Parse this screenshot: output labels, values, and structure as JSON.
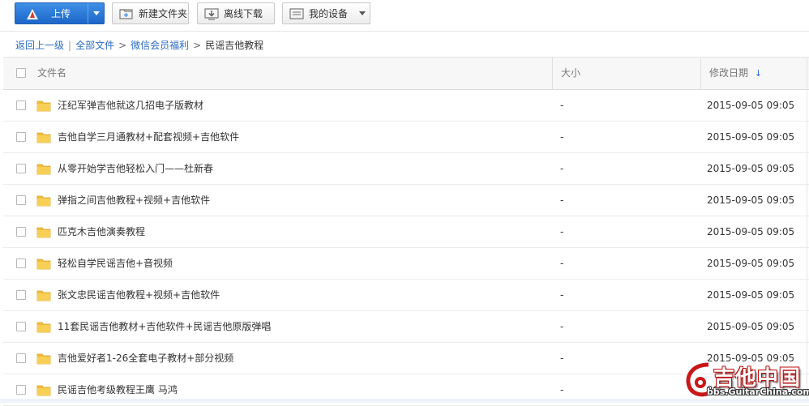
{
  "toolbar": {
    "upload_label": "上传",
    "new_folder_label": "新建文件夹",
    "offline_download_label": "离线下载",
    "my_devices_label": "我的设备"
  },
  "breadcrumb": {
    "back": "返回上一级",
    "all_files": "全部文件",
    "parent": "微信会员福利",
    "current": "民谣吉他教程",
    "separator": "|",
    "arrow": ">"
  },
  "table": {
    "columns": {
      "name": "文件名",
      "size": "大小",
      "modified": "修改日期"
    },
    "sort_indicator": "↓",
    "rows": [
      {
        "name": "汪纪军弹吉他就这几招电子版教材",
        "size": "-",
        "modified": "2015-09-05 09:05"
      },
      {
        "name": "吉他自学三月通教材+配套视频+吉他软件",
        "size": "-",
        "modified": "2015-09-05 09:05"
      },
      {
        "name": "从零开始学吉他轻松入门——杜新春",
        "size": "-",
        "modified": "2015-09-05 09:05"
      },
      {
        "name": "弹指之间吉他教程+视频+吉他软件",
        "size": "-",
        "modified": "2015-09-05 09:05"
      },
      {
        "name": "匹克木吉他演奏教程",
        "size": "-",
        "modified": "2015-09-05 09:05"
      },
      {
        "name": "轻松自学民谣吉他+音视频",
        "size": "-",
        "modified": "2015-09-05 09:05"
      },
      {
        "name": "张文忠民谣吉他教程+视频+吉他软件",
        "size": "-",
        "modified": "2015-09-05 09:05"
      },
      {
        "name": "11套民谣吉他教材+吉他软件+民谣吉他原版弹唱",
        "size": "-",
        "modified": "2015-09-05 09:05"
      },
      {
        "name": "吉他爱好者1-26全套电子教材+部分视频",
        "size": "-",
        "modified": "2015-09-05 09:05"
      },
      {
        "name": "民谣吉他考级教程王鹰 马鸿",
        "size": "-",
        "modified": "20"
      }
    ]
  },
  "watermark": {
    "title": "吉他中国",
    "url": "bbs.GuitarChina.com"
  },
  "colors": {
    "accent": "#2c6bc6",
    "upload_button": "#2a78d8",
    "folder": "#f5c542"
  },
  "icons": {
    "upload": "upload-icon",
    "new_folder": "new-folder-icon",
    "offline_download": "download-icon",
    "devices": "device-icon",
    "folder": "folder-icon"
  }
}
